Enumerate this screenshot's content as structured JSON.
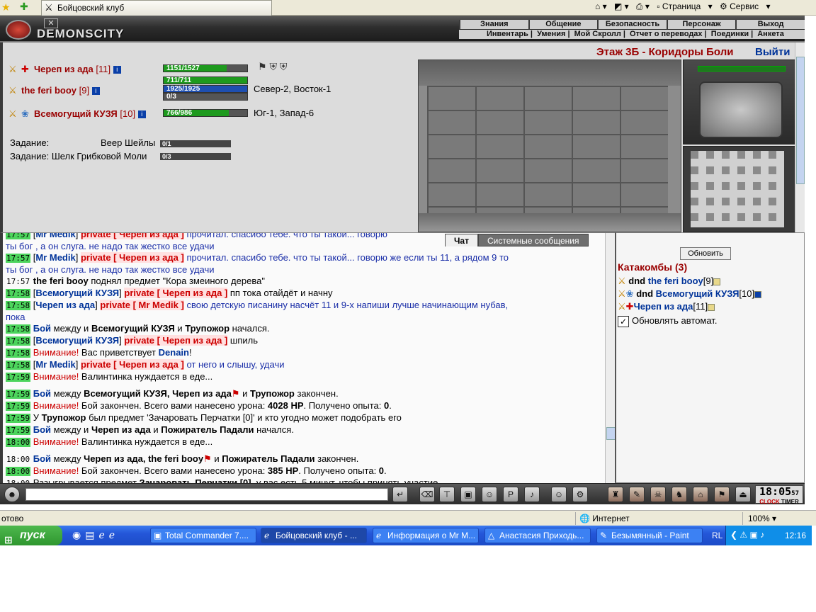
{
  "browser": {
    "tab_title": "Бойцовский клуб",
    "page_menu": "Страница",
    "service_menu": "Сервис"
  },
  "game": {
    "logo_text": "DEMONSCITY",
    "menu_top": [
      "Знания",
      "Общение",
      "Безопасность",
      "Персонаж",
      "Выход"
    ],
    "menu_bottom": [
      "Инвентарь",
      "Умения",
      "Мой Скролл",
      "Отчет о переводах",
      "Поединки",
      "Анкета"
    ],
    "floor_title": "Этаж 3Б - Коридоры Боли",
    "exit_label": "Выйти",
    "players": [
      {
        "name": "Череп из ада",
        "level": "[11]",
        "hp": "1151/1527",
        "hp_frac": 0.754
      },
      {
        "name": "the feri booy",
        "level": "[9]",
        "hp": "711/711",
        "mp": "1925/1925",
        "xp": "0/3",
        "location": "Север-2, Восток-1"
      },
      {
        "name": "Всемогущий КУЗЯ",
        "level": "[10]",
        "hp": "766/986",
        "hp_frac": 0.777,
        "location": "Юг-1, Запад-6"
      }
    ],
    "tasks": [
      {
        "label": "Задание:",
        "item": "Веер Шейлы",
        "progress": "0/1"
      },
      {
        "label": "Задание:",
        "item": "Шелк Грибковой Моли",
        "progress": "0/3"
      }
    ]
  },
  "chat": {
    "tabs": [
      "Чат",
      "Системные сообщения"
    ]
  },
  "right_panel": {
    "refresh_button": "Обновить",
    "room": "Катакомбы (3)",
    "members": [
      {
        "status": "dnd",
        "name": "the feri booy",
        "level": "[9]"
      },
      {
        "status": "dnd",
        "name": "Всемогущий КУЗЯ",
        "level": "[10]"
      },
      {
        "status": "",
        "name": "Череп из ада",
        "level": "[11]"
      }
    ],
    "auto_refresh": "Обновлять автомат."
  },
  "toolbar": {
    "clock": "18:05",
    "clock_sec": "57",
    "clock_label": "CLOCK",
    "timer_label": "TIMER"
  },
  "status_bar": {
    "left": "отово",
    "zone": "Интернет",
    "zoom": "100%"
  },
  "taskbar": {
    "start": "пуск",
    "windows": [
      "Total Commander 7....",
      "Бойцовский клуб - ...",
      "Информация о Mr M...",
      "Анастасия Приходь...",
      "Безымянный - Paint"
    ],
    "lang": "RL",
    "time": "12:16"
  }
}
